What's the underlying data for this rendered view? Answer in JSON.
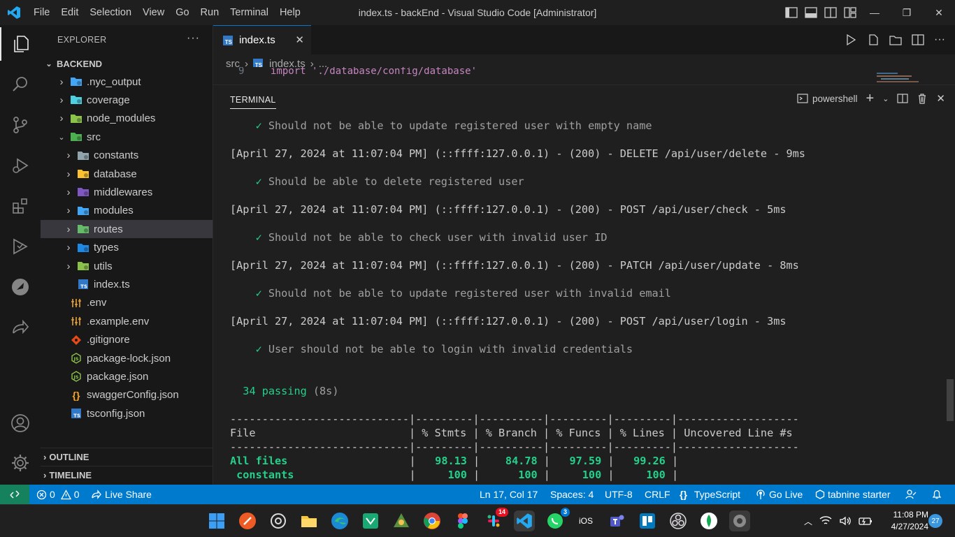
{
  "window": {
    "title": "index.ts - backEnd - Visual Studio Code [Administrator]",
    "menu": [
      "File",
      "Edit",
      "Selection",
      "View",
      "Go",
      "Run",
      "Terminal",
      "Help"
    ]
  },
  "explorer": {
    "header": "EXPLORER",
    "more": "···",
    "root": "BACKEND",
    "items": [
      {
        "label": ".nyc_output",
        "kind": "folder",
        "icon": "folder-nyc-icon",
        "color": "#42a5f5"
      },
      {
        "label": "coverage",
        "kind": "folder",
        "icon": "folder-coverage-icon",
        "color": "#4dd0e1"
      },
      {
        "label": "node_modules",
        "kind": "folder",
        "icon": "folder-node-icon",
        "color": "#8bc34a"
      },
      {
        "label": "src",
        "kind": "folder-open",
        "icon": "folder-src-icon",
        "color": "#4caf50"
      },
      {
        "label": "constants",
        "kind": "folder",
        "icon": "folder-constants-icon",
        "color": "#90a4ae"
      },
      {
        "label": "database",
        "kind": "folder",
        "icon": "folder-database-icon",
        "color": "#fbc02d"
      },
      {
        "label": "middlewares",
        "kind": "folder",
        "icon": "folder-middleware-icon",
        "color": "#7e57c2"
      },
      {
        "label": "modules",
        "kind": "folder",
        "icon": "folder-modules-icon",
        "color": "#42a5f5"
      },
      {
        "label": "routes",
        "kind": "folder",
        "icon": "folder-routes-icon",
        "color": "#66bb6a"
      },
      {
        "label": "types",
        "kind": "folder",
        "icon": "folder-types-icon",
        "color": "#1e88e5"
      },
      {
        "label": "utils",
        "kind": "folder",
        "icon": "folder-utils-icon",
        "color": "#8bc34a"
      },
      {
        "label": "index.ts",
        "kind": "file",
        "icon": "typescript-file-icon",
        "color": "#3178c6"
      },
      {
        "label": ".env",
        "kind": "file",
        "icon": "env-file-icon",
        "color": "#e8a33b"
      },
      {
        "label": ".example.env",
        "kind": "file",
        "icon": "env-file-icon",
        "color": "#e8a33b"
      },
      {
        "label": ".gitignore",
        "kind": "file",
        "icon": "git-file-icon",
        "color": "#e64a19"
      },
      {
        "label": "package-lock.json",
        "kind": "file",
        "icon": "nodejs-file-icon",
        "color": "#8bc34a"
      },
      {
        "label": "package.json",
        "kind": "file",
        "icon": "nodejs-file-icon",
        "color": "#8bc34a"
      },
      {
        "label": "swaggerConfig.json",
        "kind": "file",
        "icon": "json-file-icon",
        "color": "#f9a825"
      },
      {
        "label": "tsconfig.json",
        "kind": "file",
        "icon": "tsconfig-file-icon",
        "color": "#3178c6"
      }
    ],
    "outline": "OUTLINE",
    "timeline": "TIMELINE"
  },
  "editor": {
    "tab_label": "index.ts",
    "tab_icon_text": "TS",
    "breadcrumb": {
      "folder": "src",
      "file": "index.ts",
      "rest": "..."
    },
    "peek_line": "import  './database/config/database'"
  },
  "panel": {
    "tab": "TERMINAL",
    "shell": "powershell",
    "lines": [
      {
        "type": "test",
        "text": "Should not be able to update registered user with empty name"
      },
      {
        "type": "log",
        "text": "[April 27, 2024 at 11:07:04 PM] (::ffff:127.0.0.1) - (200) - DELETE /api/user/delete - 9ms"
      },
      {
        "type": "test",
        "text": "Should be able to delete registered user"
      },
      {
        "type": "log",
        "text": "[April 27, 2024 at 11:07:04 PM] (::ffff:127.0.0.1) - (200) - POST /api/user/check - 5ms"
      },
      {
        "type": "test",
        "text": "Should not be able to check user with invalid user ID"
      },
      {
        "type": "log",
        "text": "[April 27, 2024 at 11:07:04 PM] (::ffff:127.0.0.1) - (200) - PATCH /api/user/update - 8ms"
      },
      {
        "type": "test",
        "text": "Should not be able to update registered user with invalid email"
      },
      {
        "type": "log",
        "text": "[April 27, 2024 at 11:07:04 PM] (::ffff:127.0.0.1) - (200) - POST /api/user/login - 3ms"
      },
      {
        "type": "test",
        "text": "User should not be able to login with invalid credentials"
      }
    ],
    "passing_count": "34 passing",
    "passing_time": "(8s)",
    "coverage": {
      "separator": "----------------------------|---------|----------|---------|---------|-------------------",
      "header": "File                        | % Stmts | % Branch | % Funcs | % Lines | Uncovered Line #s",
      "rows": [
        {
          "file": "All files",
          "stmts": "98.13",
          "branch": "84.78",
          "funcs": "97.59",
          "lines": "99.26",
          "uncovered": ""
        },
        {
          "file": " constants",
          "stmts": "100",
          "branch": "100",
          "funcs": "100",
          "lines": "100",
          "uncovered": ""
        }
      ]
    }
  },
  "statusbar": {
    "errors": "0",
    "warnings": "0",
    "live_share": "Live Share",
    "position": "Ln 17, Col 17",
    "spaces": "Spaces: 4",
    "encoding": "UTF-8",
    "eol": "CRLF",
    "language": "TypeScript",
    "go_live": "Go Live",
    "tabnine": "tabnine starter"
  },
  "taskbar": {
    "badges": {
      "slack": "14",
      "whatsapp": "3"
    },
    "ios_label": "iOS",
    "time": "11:08 PM",
    "date": "4/27/2024",
    "notifications": "27"
  },
  "colors": {
    "accent": "#007acc",
    "remote": "#16825d",
    "pass": "#23d18b"
  }
}
